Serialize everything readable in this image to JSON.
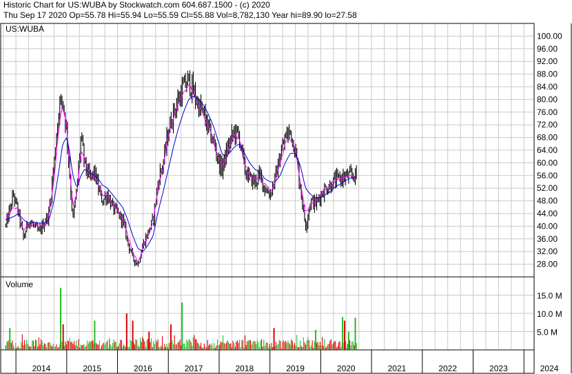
{
  "header": {
    "line1": "Historic Chart for US:WUBA by Stockwatch.com 604.687.1500 - (c) 2020",
    "line2": "Thu Sep 17 2020  Op=55.78  Hi=55.94  Lo=55.59  Cl=55.88  Vol=8,782,130  Year hi=89.90  lo=27.58"
  },
  "colors": {
    "price": "#000000",
    "ma_short": "#ff00ff",
    "ma_long": "#0000cc",
    "vol_up": "#22bb22",
    "vol_down": "#dd0000",
    "grid": "#c8c8c8"
  },
  "chart_data": [
    {
      "type": "line",
      "title": "US:WUBA",
      "ylim": [
        24,
        104
      ],
      "grid": true,
      "y_ticks": [
        "100.00",
        "96.00",
        "92.00",
        "88.00",
        "84.00",
        "80.00",
        "76.00",
        "72.00",
        "68.00",
        "64.00",
        "60.00",
        "56.00",
        "52.00",
        "48.00",
        "44.00",
        "40.00",
        "36.00",
        "32.00",
        "28.00"
      ],
      "y_tick_values": [
        100,
        96,
        92,
        88,
        84,
        80,
        76,
        72,
        68,
        64,
        60,
        56,
        52,
        48,
        44,
        40,
        36,
        32,
        28
      ],
      "x": [
        2013.8,
        2013.95,
        2014.05,
        2014.15,
        2014.25,
        2014.35,
        2014.45,
        2014.55,
        2014.65,
        2014.75,
        2014.85,
        2014.92,
        2015.0,
        2015.05,
        2015.12,
        2015.2,
        2015.28,
        2015.35,
        2015.45,
        2015.55,
        2015.62,
        2015.7,
        2015.8,
        2015.9,
        2016.0,
        2016.1,
        2016.2,
        2016.3,
        2016.4,
        2016.5,
        2016.6,
        2016.7,
        2016.75,
        2016.82,
        2016.9,
        2017.0,
        2017.1,
        2017.2,
        2017.3,
        2017.4,
        2017.5,
        2017.6,
        2017.7,
        2017.8,
        2017.9,
        2018.0,
        2018.05,
        2018.12,
        2018.2,
        2018.3,
        2018.4,
        2018.5,
        2018.6,
        2018.7,
        2018.8,
        2018.9,
        2019.0,
        2019.1,
        2019.2,
        2019.3,
        2019.4,
        2019.5,
        2019.6,
        2019.7,
        2019.8,
        2019.9,
        2020.0,
        2020.1,
        2020.2,
        2020.25,
        2020.35,
        2020.45,
        2020.55,
        2020.65,
        2020.71
      ],
      "series": [
        {
          "values": [
            40,
            50,
            44,
            36,
            42,
            40,
            38,
            41,
            44,
            60,
            78,
            80,
            70,
            58,
            42,
            52,
            68,
            60,
            55,
            57,
            52,
            48,
            50,
            46,
            44,
            42,
            35,
            30,
            28,
            34,
            38,
            42,
            48,
            56,
            60,
            70,
            76,
            80,
            84,
            86,
            82,
            78,
            75,
            70,
            66,
            60,
            58,
            62,
            66,
            70,
            68,
            58,
            55,
            54,
            56,
            52,
            50,
            55,
            62,
            68,
            70,
            64,
            52,
            40,
            48,
            47,
            50,
            52,
            53,
            54,
            55,
            55.5,
            55.8,
            55.9,
            55.88
          ]
        },
        {
          "name": "",
          "values": [
            42,
            46,
            45,
            39,
            40,
            41,
            40,
            40,
            43,
            55,
            72,
            78,
            72,
            60,
            46,
            50,
            64,
            62,
            56,
            56,
            53,
            50,
            50,
            47,
            45,
            43,
            37,
            32,
            29,
            33,
            37,
            41,
            47,
            54,
            59,
            68,
            74,
            79,
            82,
            85,
            82,
            78,
            75,
            71,
            66,
            61,
            59,
            61,
            65,
            69,
            67,
            60,
            56,
            55,
            55,
            53,
            51,
            54,
            60,
            66,
            68,
            64,
            54,
            44,
            47,
            48,
            50,
            52,
            53,
            54,
            55,
            55.3,
            55.6,
            55.8,
            55.9
          ]
        },
        {
          "name": "",
          "values": [
            42,
            43,
            44,
            42,
            41,
            41,
            41,
            41,
            42,
            48,
            58,
            66,
            68,
            64,
            56,
            52,
            56,
            58,
            57,
            56,
            55,
            53,
            52,
            50,
            48,
            46,
            42,
            37,
            33,
            32,
            34,
            37,
            41,
            46,
            51,
            58,
            65,
            71,
            76,
            80,
            81,
            80,
            78,
            75,
            71,
            66,
            63,
            62,
            63,
            65,
            66,
            63,
            60,
            58,
            57,
            55,
            54,
            54,
            56,
            60,
            63,
            63,
            59,
            52,
            50,
            49,
            49,
            50,
            51,
            52,
            53,
            54,
            55,
            55.5,
            55.6
          ]
        }
      ]
    },
    {
      "type": "bar",
      "title": "Volume",
      "ylim": [
        0,
        20
      ],
      "y_ticks": [
        "15.0 M",
        "10.0 M",
        "5.0 M"
      ],
      "y_tick_values": [
        15,
        10,
        5
      ],
      "x_ticks": [
        "2014",
        "2015",
        "2016",
        "2017",
        "2018",
        "2019",
        "2020",
        "2021",
        "2022",
        "2023",
        "2024"
      ],
      "x_tick_values": [
        2014,
        2015,
        2016,
        2017,
        2018,
        2019,
        2020,
        2021,
        2022,
        2023,
        2024
      ],
      "xlim": [
        2013.7,
        2024.2
      ],
      "spikes": [
        {
          "x": 2013.88,
          "value": 6.0,
          "dir": "up"
        },
        {
          "x": 2014.88,
          "value": 17.0,
          "dir": "up"
        },
        {
          "x": 2014.93,
          "value": 7.0,
          "dir": "down"
        },
        {
          "x": 2015.55,
          "value": 8.0,
          "dir": "up"
        },
        {
          "x": 2016.18,
          "value": 10.0,
          "dir": "down"
        },
        {
          "x": 2016.3,
          "value": 8.0,
          "dir": "down"
        },
        {
          "x": 2016.62,
          "value": 5.0,
          "dir": "down"
        },
        {
          "x": 2017.05,
          "value": 7.0,
          "dir": "down"
        },
        {
          "x": 2017.27,
          "value": 13.0,
          "dir": "up"
        },
        {
          "x": 2019.08,
          "value": 6.0,
          "dir": "down"
        },
        {
          "x": 2019.9,
          "value": 5.5,
          "dir": "up"
        },
        {
          "x": 2020.43,
          "value": 9.0,
          "dir": "up"
        },
        {
          "x": 2020.47,
          "value": 8.0,
          "dir": "down"
        },
        {
          "x": 2020.55,
          "value": 5.0,
          "dir": "up"
        },
        {
          "x": 2020.68,
          "value": 8.8,
          "dir": "up"
        }
      ],
      "base_range": [
        0.5,
        3.0
      ],
      "data_end": 2020.71
    }
  ]
}
